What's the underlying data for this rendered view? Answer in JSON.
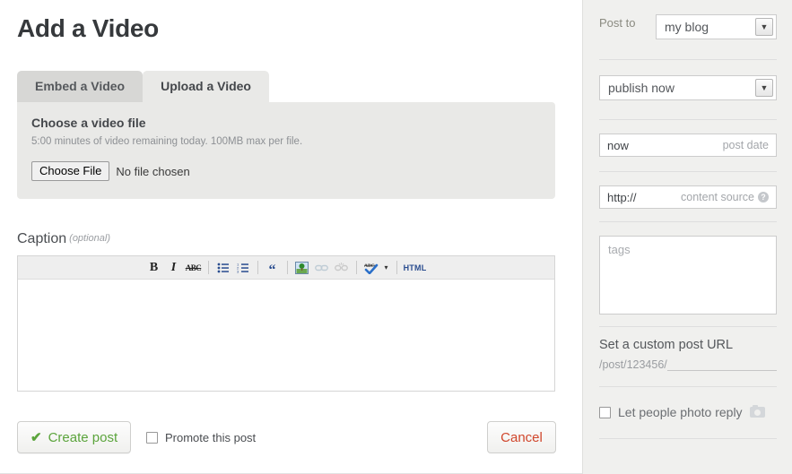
{
  "page": {
    "title": "Add a Video"
  },
  "tabs": [
    {
      "label": "Embed a Video",
      "active": false
    },
    {
      "label": "Upload a Video",
      "active": true
    }
  ],
  "upload_panel": {
    "heading": "Choose a video file",
    "subtext": "5:00 minutes of video remaining today. 100MB max per file.",
    "choose_file_label": "Choose File",
    "file_status": "No file chosen"
  },
  "caption": {
    "label": "Caption",
    "optional_note": "(optional)",
    "value": "",
    "toolbar": [
      {
        "name": "bold-icon",
        "glyph": "B"
      },
      {
        "name": "italic-icon",
        "glyph": "I"
      },
      {
        "name": "strikethrough-icon",
        "glyph": "ABC"
      },
      {
        "name": "unordered-list-icon",
        "glyph": ""
      },
      {
        "name": "ordered-list-icon",
        "glyph": ""
      },
      {
        "name": "blockquote-icon",
        "glyph": "“"
      },
      {
        "name": "insert-image-icon",
        "glyph": ""
      },
      {
        "name": "insert-link-icon",
        "glyph": ""
      },
      {
        "name": "unlink-icon",
        "glyph": ""
      },
      {
        "name": "spellcheck-icon",
        "glyph": "ABC"
      },
      {
        "name": "spellcheck-dropdown-icon",
        "glyph": "▾"
      },
      {
        "name": "html-toggle-button",
        "glyph": "HTML"
      }
    ]
  },
  "footer": {
    "create_post_label": "Create post",
    "create_post_check": "✔",
    "promote_label": "Promote this post",
    "promote_checked": false,
    "cancel_label": "Cancel"
  },
  "sidebar": {
    "post_to_label": "Post to",
    "blog_selected": "my blog",
    "publish_selected": "publish now",
    "post_date_value": "now",
    "post_date_hint": "post date",
    "content_source_value": "http://",
    "content_source_hint": "content source",
    "content_source_help": "?",
    "tags_placeholder": "tags",
    "custom_url_title": "Set a custom post URL",
    "custom_url_prefix": "/post/123456/",
    "custom_url_value": "",
    "photo_reply_label": "Let people photo reply",
    "photo_reply_checked": false
  },
  "colors": {
    "page_bg": "#ffffff",
    "sidebar_bg": "#f0f0ee",
    "panel_bg": "#e9e9e7",
    "tab_inactive_bg": "#d7d7d5",
    "title_text": "#36393c",
    "create_post_green": "#5ba43c",
    "cancel_red": "#d0462c",
    "muted_text": "#8d9094"
  }
}
